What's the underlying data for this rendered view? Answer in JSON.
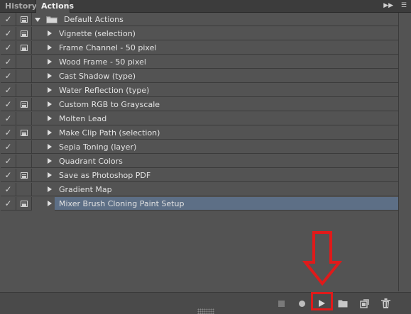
{
  "tabs": [
    {
      "label": "History",
      "active": false
    },
    {
      "label": "Actions",
      "active": true
    }
  ],
  "tab_controls": {
    "expand_icon": "double-chevron-right-icon",
    "menu_icon": "panel-menu-icon"
  },
  "action_set": {
    "label": "Default Actions",
    "expanded": true,
    "enabled": true,
    "dialog": "partial"
  },
  "actions": [
    {
      "label": "Vignette (selection)",
      "enabled": true,
      "dialog": "on"
    },
    {
      "label": "Frame Channel - 50 pixel",
      "enabled": true,
      "dialog": "on"
    },
    {
      "label": "Wood Frame - 50 pixel",
      "enabled": true,
      "dialog": "off"
    },
    {
      "label": "Cast Shadow (type)",
      "enabled": true,
      "dialog": "off"
    },
    {
      "label": "Water Reflection (type)",
      "enabled": true,
      "dialog": "off"
    },
    {
      "label": "Custom RGB to Grayscale",
      "enabled": true,
      "dialog": "on"
    },
    {
      "label": "Molten Lead",
      "enabled": true,
      "dialog": "off"
    },
    {
      "label": "Make Clip Path (selection)",
      "enabled": true,
      "dialog": "on"
    },
    {
      "label": "Sepia Toning (layer)",
      "enabled": true,
      "dialog": "off"
    },
    {
      "label": "Quadrant Colors",
      "enabled": true,
      "dialog": "off"
    },
    {
      "label": "Save as Photoshop PDF",
      "enabled": true,
      "dialog": "on"
    },
    {
      "label": "Gradient Map",
      "enabled": true,
      "dialog": "off"
    },
    {
      "label": "Mixer Brush Cloning Paint Setup",
      "enabled": true,
      "dialog": "on",
      "selected": true
    }
  ],
  "bottom_toolbar": [
    {
      "name": "stop-playing-recording-button",
      "icon": "stop-icon"
    },
    {
      "name": "begin-recording-button",
      "icon": "record-icon"
    },
    {
      "name": "play-selection-button",
      "icon": "play-icon",
      "highlighted": true
    },
    {
      "name": "create-new-set-button",
      "icon": "folder-icon"
    },
    {
      "name": "create-new-action-button",
      "icon": "new-item-icon"
    },
    {
      "name": "delete-button",
      "icon": "trash-icon"
    }
  ],
  "colors": {
    "panel_bg": "#535353",
    "selected_row": "#5d6f86",
    "annotation_red": "#e01a1a"
  }
}
